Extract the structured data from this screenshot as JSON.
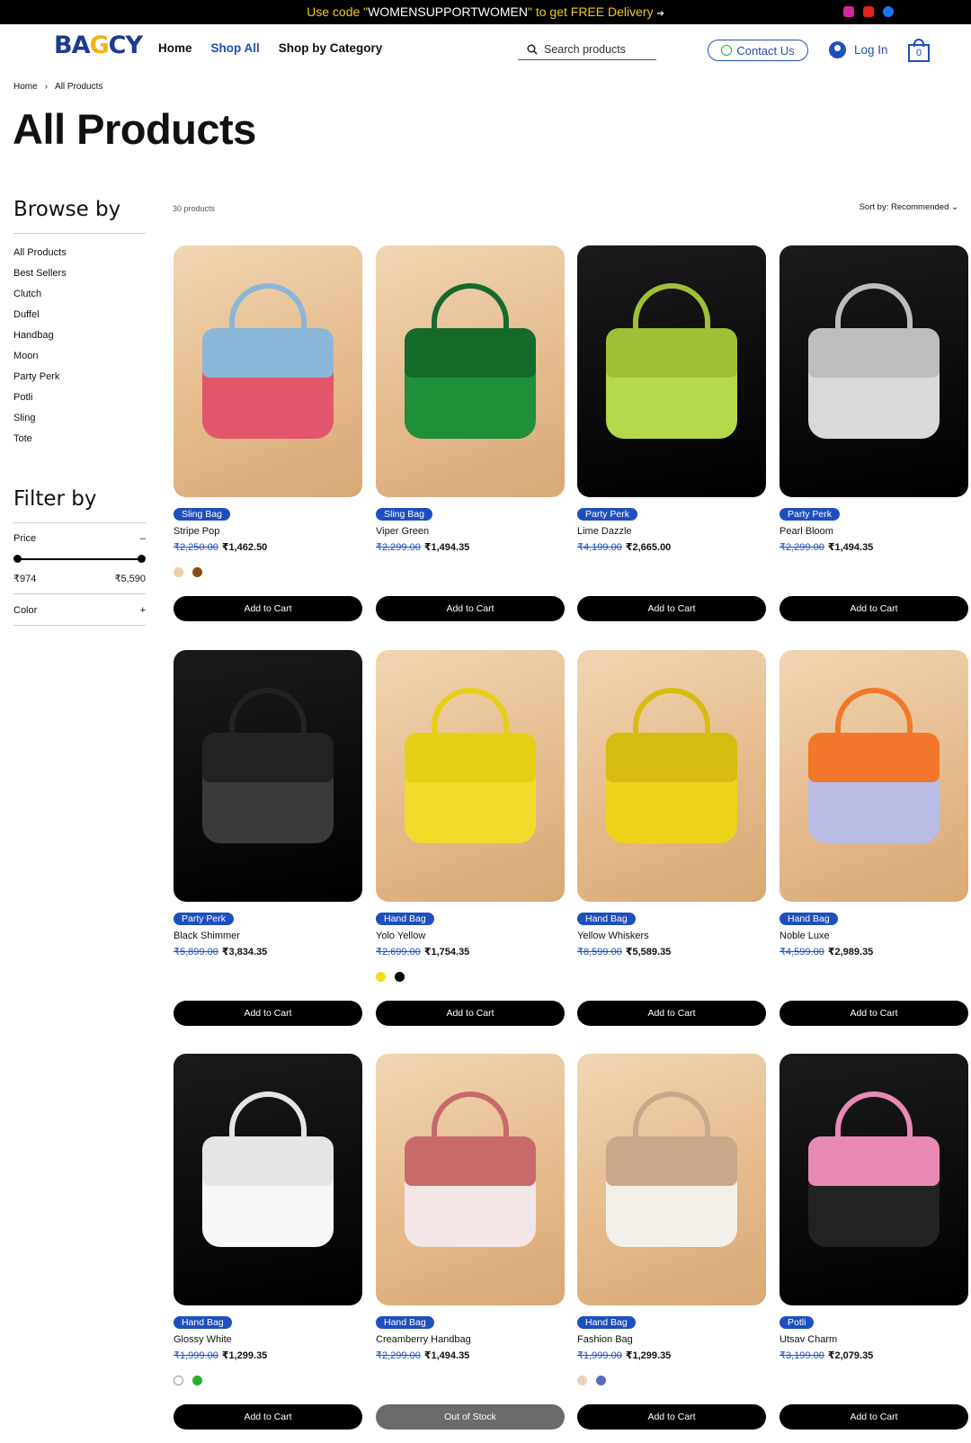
{
  "announcement": {
    "part1": "Use code \"",
    "code": "WOMENSUPPORTWOMEN",
    "part2": "\" to get ",
    "highlight": "FREE Delivery",
    "arrow": "➔",
    "socials": [
      "instagram-icon",
      "youtube-icon",
      "facebook-icon"
    ]
  },
  "header": {
    "logo": "BAGCY",
    "nav": [
      "Home",
      "Shop All",
      "Shop by Category"
    ],
    "active_nav": "Shop All",
    "search_placeholder": "Search products",
    "contact_label": "Contact Us",
    "login_label": "Log In",
    "cart_count": "0"
  },
  "breadcrumb": [
    "Home",
    "All Products"
  ],
  "page_title": "All Products",
  "sidebar": {
    "browse_title": "Browse by",
    "categories": [
      "All Products",
      "Best Sellers",
      "Clutch",
      "Duffel",
      "Handbag",
      "Moon",
      "Party Perk",
      "Potli",
      "Sling",
      "Tote"
    ],
    "filter_title": "Filter by",
    "price_label": "Price",
    "price_min": "₹974",
    "price_max": "₹5,590",
    "color_label": "Color"
  },
  "listing": {
    "count": "30 products",
    "sort": "Sort by: Recommended"
  },
  "products": [
    {
      "category": "Sling Bag",
      "name": "Stripe Pop",
      "old_price": "₹2,250.00",
      "price": "₹1,462.50",
      "swatches": [
        "#f0cfa6",
        "#8a4a12"
      ],
      "button": "Add to Cart",
      "bg": "beige"
    },
    {
      "category": "Sling Bag",
      "name": "Viper Green",
      "old_price": "₹2,299.00",
      "price": "₹1,494.35",
      "swatches": [],
      "button": "Add to Cart",
      "bg": "beige"
    },
    {
      "category": "Party Perk",
      "name": "Lime Dazzle",
      "old_price": "₹4,199.00",
      "price": "₹2,665.00",
      "swatches": [],
      "button": "Add to Cart",
      "bg": "dark"
    },
    {
      "category": "Party Perk",
      "name": "Pearl Bloom",
      "old_price": "₹2,299.00",
      "price": "₹1,494.35",
      "swatches": [],
      "button": "Add to Cart",
      "bg": "dark"
    },
    {
      "category": "Party Perk",
      "name": "Black Shimmer",
      "old_price": "₹5,899.00",
      "price": "₹3,834.35",
      "swatches": [],
      "button": "Add to Cart",
      "bg": "dark"
    },
    {
      "category": "Hand Bag",
      "name": "Yolo Yellow",
      "old_price": "₹2,699.00",
      "price": "₹1,754.35",
      "swatches": [
        "#f2dd1c",
        "#000000"
      ],
      "button": "Add to Cart",
      "bg": "beige"
    },
    {
      "category": "Hand Bag",
      "name": "Yellow Whiskers",
      "old_price": "₹8,599.00",
      "price": "₹5,589.35",
      "swatches": [],
      "button": "Add to Cart",
      "bg": "beige"
    },
    {
      "category": "Hand Bag",
      "name": "Noble Luxe",
      "old_price": "₹4,599.00",
      "price": "₹2,989.35",
      "swatches": [],
      "button": "Add to Cart",
      "bg": "beige"
    },
    {
      "category": "Hand Bag",
      "name": "Glossy White",
      "old_price": "₹1,999.00",
      "price": "₹1,299.35",
      "swatches": [
        "#ffffff",
        "#22b22b"
      ],
      "button": "Add to Cart",
      "bg": "dark"
    },
    {
      "category": "Hand Bag",
      "name": "Creamberry Handbag",
      "old_price": "₹2,299.00",
      "price": "₹1,494.35",
      "swatches": [],
      "button": "Out of Stock",
      "bg": "beige"
    },
    {
      "category": "Hand Bag",
      "name": "Fashion Bag",
      "old_price": "₹1,999.00",
      "price": "₹1,299.35",
      "swatches": [
        "#e8d3bd",
        "#5c6bc0"
      ],
      "button": "Add to Cart",
      "bg": "beige"
    },
    {
      "category": "Potli",
      "name": "Utsav Charm",
      "old_price": "₹3,199.00",
      "price": "₹2,079.35",
      "swatches": [],
      "button": "Add to Cart",
      "bg": "dark"
    }
  ]
}
